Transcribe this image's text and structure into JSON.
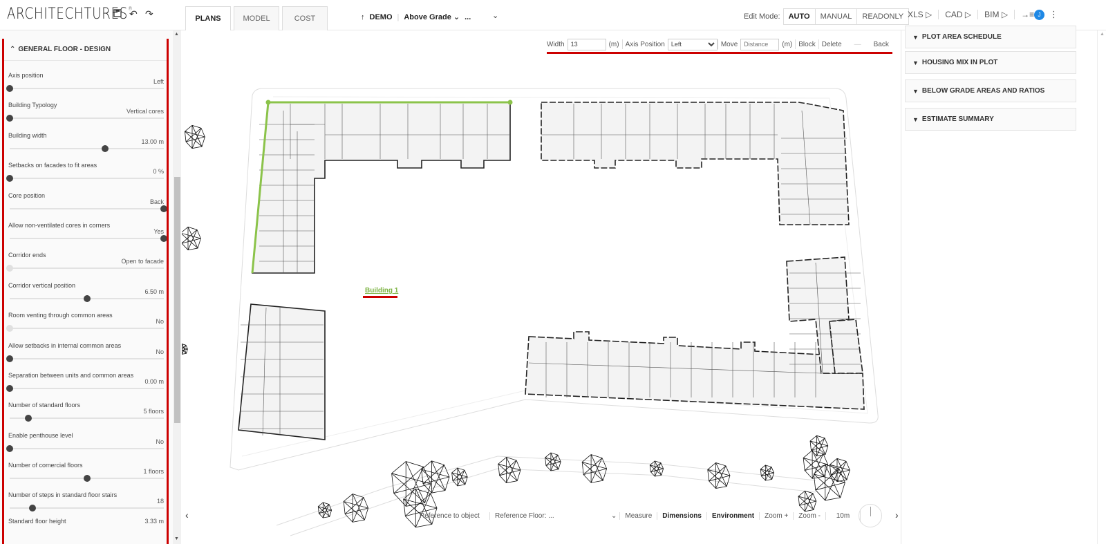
{
  "app": {
    "logo": "ARCHITECHTURES",
    "logo_mark": "®"
  },
  "toolbar": {
    "save_icon": "💾",
    "undo_icon": "↶",
    "redo_icon": "↷"
  },
  "tabs": [
    {
      "label": "PLANS",
      "active": true
    },
    {
      "label": "MODEL",
      "active": false
    },
    {
      "label": "COST",
      "active": false
    }
  ],
  "project": {
    "up_icon": "↑",
    "name": "DEMO",
    "separator": "|",
    "level": "Above Grade ⌄",
    "ellipsis": "...",
    "chevron": "⌄"
  },
  "edit_mode": {
    "label": "Edit Mode:",
    "options": [
      {
        "label": "AUTO",
        "selected": true
      },
      {
        "label": "MANUAL",
        "selected": false
      },
      {
        "label": "READONLY",
        "selected": false
      }
    ]
  },
  "exports": [
    {
      "label": "XLS ▷"
    },
    {
      "label": "CAD ▷"
    },
    {
      "label": "BIM ▷"
    },
    {
      "label": "→≡"
    }
  ],
  "user": {
    "avatar_initial": "J",
    "menu_icon": "⋮"
  },
  "left_panel": {
    "section_title": "GENERAL FLOOR - DESIGN",
    "section_icon": "⌃",
    "params": [
      {
        "label": "Axis position",
        "value": "Left",
        "pos": 0.0,
        "enabled": true
      },
      {
        "label": "Building Typology",
        "value": "Vertical cores",
        "pos": 0.0,
        "enabled": true
      },
      {
        "label": "Building width",
        "value": "13.00  m",
        "pos": 0.62,
        "enabled": true
      },
      {
        "label": "Setbacks on facades to fit areas",
        "value": "0  %",
        "pos": 0.0,
        "enabled": true
      },
      {
        "label": "Core position",
        "value": "Back",
        "pos": 1.0,
        "enabled": true
      },
      {
        "label": "Allow non-ventilated cores in corners",
        "value": "Yes",
        "pos": 1.0,
        "enabled": true
      },
      {
        "label": "Corridor ends",
        "value": "Open to facade",
        "pos": 0.0,
        "enabled": false
      },
      {
        "label": "Corridor vertical position",
        "value": "6.50  m",
        "pos": 0.5,
        "enabled": true
      },
      {
        "label": "Room venting through common areas",
        "value": "No",
        "pos": 0.0,
        "enabled": false
      },
      {
        "label": "Allow setbacks in internal common areas",
        "value": "No",
        "pos": 0.0,
        "enabled": true
      },
      {
        "label": "Separation between units and common areas",
        "value": "0.00  m",
        "pos": 0.0,
        "enabled": true
      },
      {
        "label": "Number of standard floors",
        "value": "5  floors",
        "pos": 0.12,
        "enabled": true
      },
      {
        "label": "Enable penthouse level",
        "value": "No",
        "pos": 0.0,
        "enabled": true
      },
      {
        "label": "Number of comercial floors",
        "value": "1  floors",
        "pos": 0.5,
        "enabled": true
      },
      {
        "label": "Number of steps in standard floor stairs",
        "value": "18",
        "pos": 0.15,
        "enabled": true
      },
      {
        "label": "Standard floor height",
        "value": "3.33  m",
        "pos": null,
        "enabled": true
      }
    ]
  },
  "edit_strip": {
    "width_label": "Width",
    "width_value": "13",
    "unit_m": "(m)",
    "axis_label": "Axis Position",
    "axis_value": "Left",
    "move_label": "Move",
    "move_placeholder": "Distance",
    "block_label": "Block",
    "delete_label": "Delete",
    "dash": "—",
    "back_label": "Back"
  },
  "canvas": {
    "building_label": "Building 1",
    "highlight_color": "#8bc34a"
  },
  "bottom_bar": {
    "reference_object": "Reference to object",
    "reference_floor": "Reference Floor: ...",
    "chevron": "⌄",
    "measure": "Measure",
    "dimensions": "Dimensions",
    "environment": "Environment",
    "zoom_in": "Zoom +",
    "zoom_out": "Zoom -",
    "scale": "10m",
    "prev_icon": "‹",
    "next_icon": "›"
  },
  "right_panel": {
    "sections": [
      {
        "label": "PLOT AREA SCHEDULE"
      },
      {
        "label": "HOUSING MIX IN PLOT"
      },
      {
        "label": "BELOW GRADE AREAS AND RATIOS"
      },
      {
        "label": "ESTIMATE SUMMARY"
      }
    ],
    "chevron": "⌄"
  }
}
